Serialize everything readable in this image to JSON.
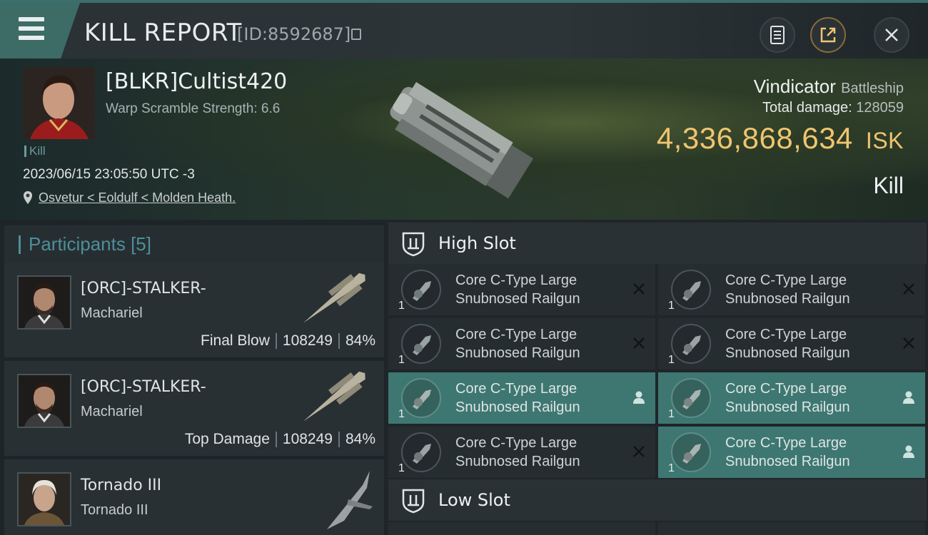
{
  "header": {
    "title": "KILL REPORT",
    "report_id": "[ID:8592687]"
  },
  "victim": {
    "pilot_name": "[BLKR]Cultist420",
    "warp_scramble": "Warp Scramble Strength: 6.6",
    "tag": "Kill",
    "datetime": "2023/06/15 23:05:50 UTC -3",
    "location": "Osvetur < Eoldulf < Molden Heath.",
    "ship_name": "Vindicator",
    "ship_class": "Battleship",
    "total_damage_label": "Total damage:",
    "total_damage": "128059",
    "isk_value": "4,336,868,634",
    "isk_unit": "ISK",
    "result": "Kill"
  },
  "participants": {
    "label": "Participants",
    "count": "[5]",
    "rows": [
      {
        "name": "[ORC]-STALKER-",
        "ship": "Machariel",
        "role": "Final Blow",
        "damage": "108249",
        "percent": "84%"
      },
      {
        "name": "[ORC]-STALKER-",
        "ship": "Machariel",
        "role": "Top Damage",
        "damage": "108249",
        "percent": "84%"
      },
      {
        "name": "Tornado III",
        "ship": "Tornado III"
      }
    ]
  },
  "slots": {
    "high": {
      "label": "High Slot",
      "items": [
        {
          "line1": "Core C-Type Large",
          "line2": "Snubnosed Railgun",
          "qty": "1",
          "status": "destroyed"
        },
        {
          "line1": "Core C-Type Large",
          "line2": "Snubnosed Railgun",
          "qty": "1",
          "status": "destroyed"
        },
        {
          "line1": "Core C-Type Large",
          "line2": "Snubnosed Railgun",
          "qty": "1",
          "status": "destroyed"
        },
        {
          "line1": "Core C-Type Large",
          "line2": "Snubnosed Railgun",
          "qty": "1",
          "status": "destroyed"
        },
        {
          "line1": "Core C-Type Large",
          "line2": "Snubnosed Railgun",
          "qty": "1",
          "status": "dropped"
        },
        {
          "line1": "Core C-Type Large",
          "line2": "Snubnosed Railgun",
          "qty": "1",
          "status": "dropped"
        },
        {
          "line1": "Core C-Type Large",
          "line2": "Snubnosed Railgun",
          "qty": "1",
          "status": "destroyed"
        },
        {
          "line1": "Core C-Type Large",
          "line2": "Snubnosed Railgun",
          "qty": "1",
          "status": "dropped"
        }
      ]
    },
    "low": {
      "label": "Low Slot"
    }
  },
  "colors": {
    "isk": "#f0c46e",
    "accent": "#4e8f98",
    "dropped_bg": "#3e7771"
  },
  "icons": [
    "menu-icon",
    "copy-icon",
    "clipboard-icon",
    "share-icon",
    "close-icon",
    "location-pin-icon",
    "shield-slot-icon",
    "x-destroyed-icon",
    "person-dropped-icon"
  ]
}
